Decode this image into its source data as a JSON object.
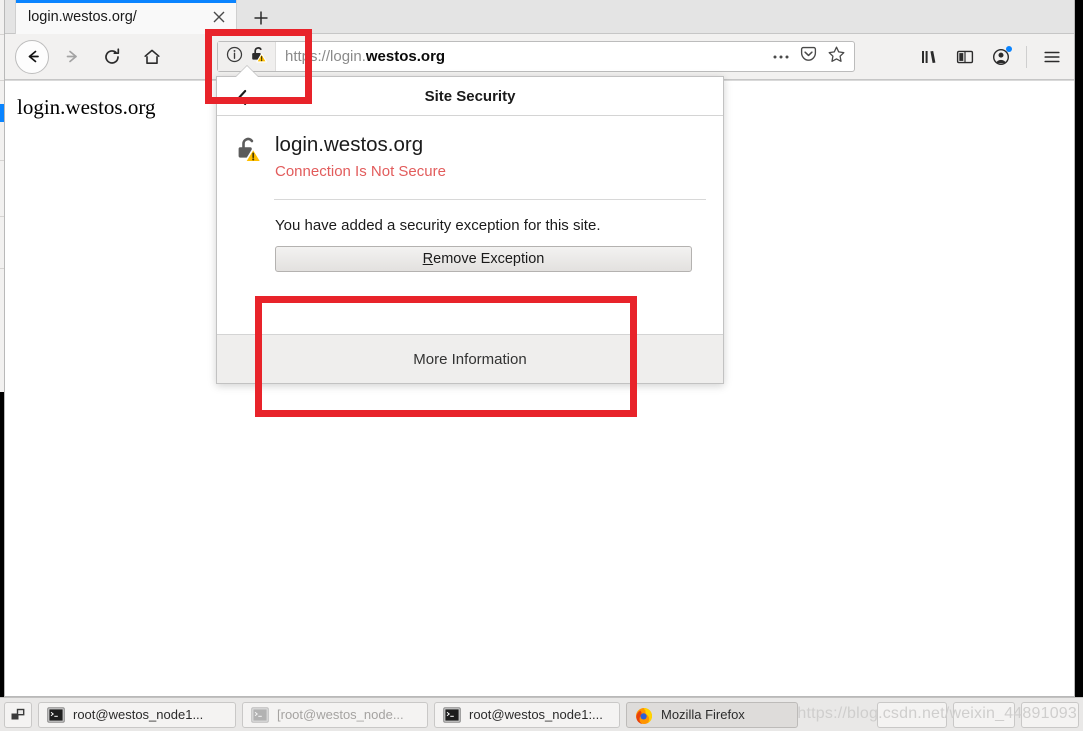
{
  "browser": {
    "tab": {
      "title": "login.westos.org/",
      "close_icon": "close-icon"
    },
    "new_tab_label": "+",
    "nav": {
      "back": "back-arrow-icon",
      "forward": "forward-arrow-icon",
      "reload": "reload-icon",
      "home": "home-icon"
    },
    "urlbar": {
      "identity_info_icon": "info-circle-icon",
      "identity_lock_icon": "broken-lock-warning-icon",
      "url_scheme": "https://login.",
      "url_host": "westos.org",
      "page_actions_icon": "ellipsis-icon",
      "pocket_icon": "pocket-icon",
      "bookmark_icon": "star-icon"
    },
    "toolbar_right": {
      "library_icon": "library-icon",
      "sidebar_icon": "sidebar-icon",
      "account_icon": "account-icon",
      "menu_icon": "hamburger-menu-icon"
    }
  },
  "page": {
    "body_text": "login.westos.org"
  },
  "panel": {
    "back_icon": "chevron-left-icon",
    "title": "Site Security",
    "lock_icon": "broken-lock-warning-icon",
    "host": "login.westos.org",
    "status": "Connection Is Not Secure",
    "status_color": "#e25c5c",
    "exception_text": "You have added a security exception for this site.",
    "remove_button": {
      "accesskey": "R",
      "rest": "emove Exception"
    },
    "footer_label": "More Information"
  },
  "annotations": {
    "accent_color": "#e8232a",
    "boxes": [
      {
        "name": "identity-button-highlight"
      },
      {
        "name": "more-information-highlight"
      }
    ]
  },
  "taskbar": {
    "show_desktop_icon": "show-desktop-icon",
    "items": [
      {
        "label": "root@westos_node1...",
        "icon": "terminal-icon",
        "state": "normal"
      },
      {
        "label": "[root@westos_node...",
        "icon": "terminal-icon",
        "state": "inactive"
      },
      {
        "label": "root@westos_node1:...",
        "icon": "terminal-icon",
        "state": "normal"
      },
      {
        "label": "Mozilla Firefox",
        "icon": "firefox-icon",
        "state": "active"
      }
    ]
  },
  "watermark": {
    "text": "https://blog.csdn.net/weixin_44891093"
  }
}
